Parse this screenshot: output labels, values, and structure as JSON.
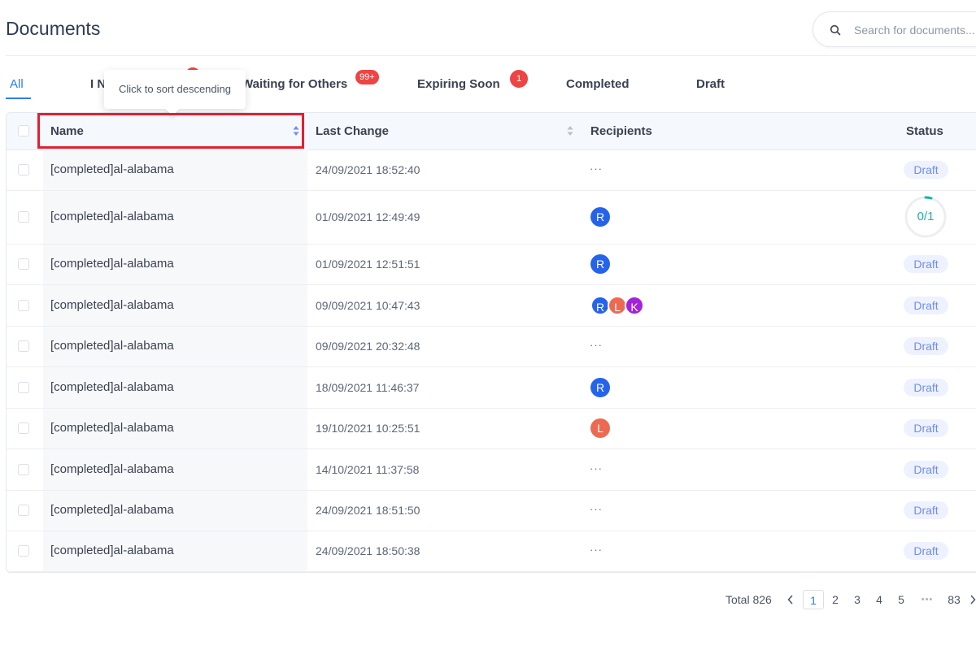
{
  "header": {
    "title": "Documents",
    "search_placeholder": "Search for documents..."
  },
  "tabs": [
    {
      "label": "All",
      "active": true
    },
    {
      "label": "I Need to Sign",
      "badge": ""
    },
    {
      "label": "Waiting for Others",
      "badge": "99+"
    },
    {
      "label": "Expiring Soon",
      "badge": "1"
    },
    {
      "label": "Completed"
    },
    {
      "label": "Draft"
    }
  ],
  "tooltip": "Click to sort descending",
  "table": {
    "columns": {
      "name": "Name",
      "last_change": "Last Change",
      "recipients": "Recipients",
      "status": "Status"
    },
    "rows": [
      {
        "name": "[completed]al-alabama",
        "date": "24/09/2021 18:52:40",
        "recipients": [],
        "recipients_text": "···",
        "status": "Draft"
      },
      {
        "name": "[completed]al-alabama",
        "date": "01/09/2021 12:49:49",
        "recipients": [
          "R"
        ],
        "recipients_text": "",
        "status": "",
        "progress": "0/1"
      },
      {
        "name": "[completed]al-alabama",
        "date": "01/09/2021 12:51:51",
        "recipients": [
          "R"
        ],
        "recipients_text": "",
        "status": "Draft"
      },
      {
        "name": "[completed]al-alabama",
        "date": "09/09/2021 10:47:43",
        "recipients": [
          "R",
          "L",
          "K"
        ],
        "recipients_text": "",
        "status": "Draft"
      },
      {
        "name": "[completed]al-alabama",
        "date": "09/09/2021 20:32:48",
        "recipients": [],
        "recipients_text": "···",
        "status": "Draft"
      },
      {
        "name": "[completed]al-alabama",
        "date": "18/09/2021 11:46:37",
        "recipients": [
          "R"
        ],
        "recipients_text": "",
        "status": "Draft"
      },
      {
        "name": "[completed]al-alabama",
        "date": "19/10/2021 10:25:51",
        "recipients": [
          "L"
        ],
        "recipients_text": "",
        "status": "Draft"
      },
      {
        "name": "[completed]al-alabama",
        "date": "14/10/2021 11:37:58",
        "recipients": [],
        "recipients_text": "···",
        "status": "Draft"
      },
      {
        "name": "[completed]al-alabama",
        "date": "24/09/2021 18:51:50",
        "recipients": [],
        "recipients_text": "···",
        "status": "Draft"
      },
      {
        "name": "[completed]al-alabama",
        "date": "24/09/2021 18:50:38",
        "recipients": [],
        "recipients_text": "···",
        "status": "Draft"
      }
    ]
  },
  "pagination": {
    "total_label": "Total 826",
    "pages": [
      "1",
      "2",
      "3",
      "4",
      "5",
      "•••",
      "83"
    ],
    "current": "1"
  },
  "colors": {
    "accent": "#2d7df0",
    "badge": "#ef4444",
    "avatar_R": "#2563eb",
    "avatar_L": "#ec6a52",
    "avatar_K": "#a324d6",
    "highlight": "#e21f2f"
  },
  "icons": {
    "search": "search-icon",
    "sort": "sort-icon",
    "prev": "chevron-left-icon",
    "next": "chevron-right-icon"
  }
}
